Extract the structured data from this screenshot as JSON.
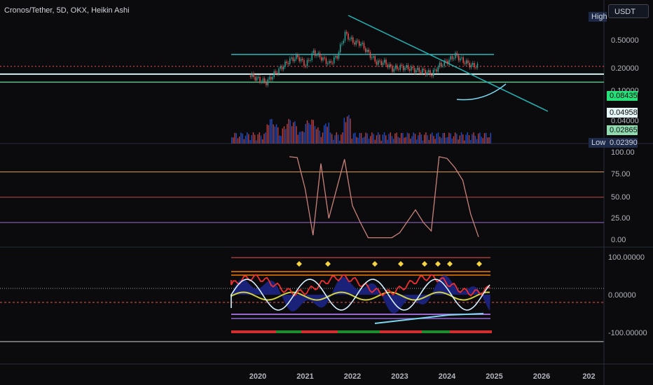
{
  "title": "Cronos/Tether, 5D, OKX, Heikin Ashi",
  "currency_button": "USDT",
  "price_labels": {
    "high": "High",
    "low": "Low",
    "current": "0.08435",
    "support1": "0.04958",
    "support2": "0.02865",
    "low_value": "0.02390"
  },
  "colors": {
    "background": "#0b0b0d",
    "candle_up": "#26a69a",
    "candle_down": "#ef5350",
    "trendline": "#22b5b8",
    "horizontal_resistance": "#22b5b8",
    "support_white": "#d0f0f0",
    "support_green": "#5fbf8a",
    "current_price": "#26e07a",
    "rsi_line": "#c8827a",
    "overbought": "#e0a040",
    "oversold": "#9a6ad0",
    "curve": "#7ad8f0"
  },
  "chart_data": [
    {
      "type": "candlestick",
      "pane": "price",
      "title": "Cronos/Tether, 5D, OKX, Heikin Ashi",
      "scale": "log",
      "y_ticks": [
        "0.50000",
        "0.20000",
        "0.10000",
        "0.04000"
      ],
      "x_ticks": [
        "2020",
        "2021",
        "2022",
        "2023",
        "2024",
        "2025",
        "2026",
        "202"
      ],
      "close_series": [
        {
          "x": "2019-11",
          "y": 0.045
        },
        {
          "x": "2020-01",
          "y": 0.035
        },
        {
          "x": "2020-03",
          "y": 0.028
        },
        {
          "x": "2020-05",
          "y": 0.05
        },
        {
          "x": "2020-07",
          "y": 0.08
        },
        {
          "x": "2020-09",
          "y": 0.13
        },
        {
          "x": "2020-11",
          "y": 0.16
        },
        {
          "x": "2021-01",
          "y": 0.09
        },
        {
          "x": "2021-03",
          "y": 0.22
        },
        {
          "x": "2021-05",
          "y": 0.15
        },
        {
          "x": "2021-07",
          "y": 0.1
        },
        {
          "x": "2021-09",
          "y": 0.17
        },
        {
          "x": "2021-11",
          "y": 0.78
        },
        {
          "x": "2022-01",
          "y": 0.45
        },
        {
          "x": "2022-03",
          "y": 0.4
        },
        {
          "x": "2022-05",
          "y": 0.2
        },
        {
          "x": "2022-07",
          "y": 0.11
        },
        {
          "x": "2022-09",
          "y": 0.11
        },
        {
          "x": "2022-11",
          "y": 0.07
        },
        {
          "x": "2023-01",
          "y": 0.08
        },
        {
          "x": "2023-03",
          "y": 0.075
        },
        {
          "x": "2023-05",
          "y": 0.065
        },
        {
          "x": "2023-07",
          "y": 0.06
        },
        {
          "x": "2023-09",
          "y": 0.05
        },
        {
          "x": "2023-11",
          "y": 0.09
        },
        {
          "x": "2024-01",
          "y": 0.12
        },
        {
          "x": "2024-03",
          "y": 0.18
        },
        {
          "x": "2024-05",
          "y": 0.12
        },
        {
          "x": "2024-07",
          "y": 0.09
        },
        {
          "x": "2024-09",
          "y": 0.085
        }
      ],
      "lines": {
        "horizontal_resistance": 0.19,
        "support1": 0.04958,
        "support2": 0.02865,
        "current": 0.08435
      }
    },
    {
      "type": "line",
      "pane": "oscillator",
      "y_ticks": [
        "100.00",
        "75.00",
        "50.00",
        "25.00",
        "0.00"
      ],
      "levels": [
        80,
        50,
        20
      ],
      "series": [
        {
          "values": [
            {
              "x": "2020-09",
              "y": 98
            },
            {
              "x": "2020-11",
              "y": 97
            },
            {
              "x": "2021-01",
              "y": 60
            },
            {
              "x": "2021-03",
              "y": 5
            },
            {
              "x": "2021-05",
              "y": 90
            },
            {
              "x": "2021-07",
              "y": 25
            },
            {
              "x": "2021-09",
              "y": 60
            },
            {
              "x": "2021-11",
              "y": 95
            },
            {
              "x": "2022-01",
              "y": 40
            },
            {
              "x": "2022-03",
              "y": 20
            },
            {
              "x": "2022-05",
              "y": 2
            },
            {
              "x": "2022-11",
              "y": 2
            },
            {
              "x": "2023-01",
              "y": 8
            },
            {
              "x": "2023-05",
              "y": 35
            },
            {
              "x": "2023-07",
              "y": 20
            },
            {
              "x": "2023-09",
              "y": 10
            },
            {
              "x": "2023-11",
              "y": 98
            },
            {
              "x": "2024-01",
              "y": 96
            },
            {
              "x": "2024-03",
              "y": 85
            },
            {
              "x": "2024-05",
              "y": 70
            },
            {
              "x": "2024-07",
              "y": 30
            },
            {
              "x": "2024-09",
              "y": 3
            }
          ]
        }
      ]
    },
    {
      "type": "area",
      "pane": "momentum",
      "y_ticks": [
        "100.00000",
        "0.00000",
        "-100.00000"
      ]
    }
  ]
}
